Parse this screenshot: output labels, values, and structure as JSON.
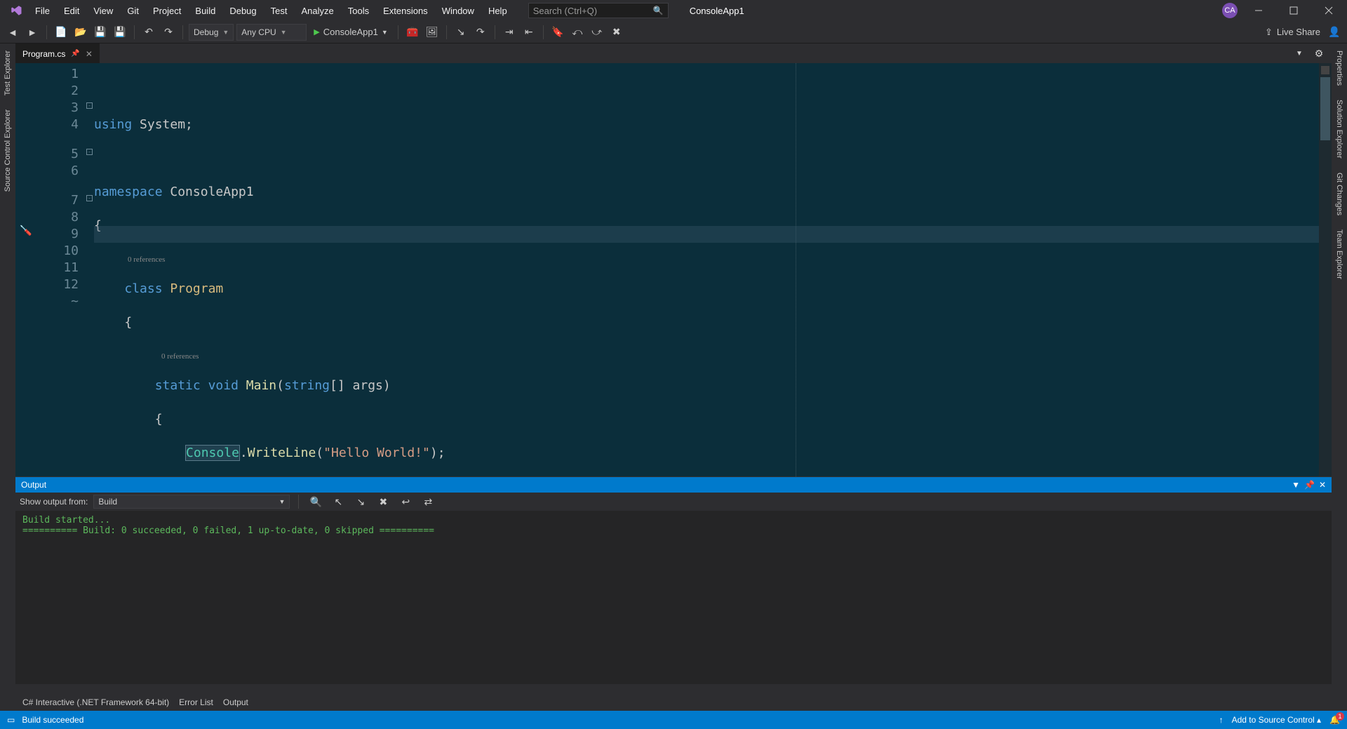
{
  "menu": [
    "File",
    "Edit",
    "View",
    "Git",
    "Project",
    "Build",
    "Debug",
    "Test",
    "Analyze",
    "Tools",
    "Extensions",
    "Window",
    "Help"
  ],
  "search_placeholder": "Search (Ctrl+Q)",
  "app_title": "ConsoleApp1",
  "user_initials": "CA",
  "toolbar": {
    "config": "Debug",
    "platform": "Any CPU",
    "start_target": "ConsoleApp1",
    "live_share": "Live Share"
  },
  "left_rails": [
    "Test Explorer",
    "Source Control Explorer"
  ],
  "right_rails": [
    "Properties",
    "Solution Explorer",
    "Git Changes",
    "Team Explorer"
  ],
  "doc_tab": "Program.cs",
  "code": {
    "line_numbers": [
      "1",
      "2",
      "3",
      "4",
      "",
      "5",
      "6",
      "",
      "7",
      "8",
      "9",
      "10",
      "11",
      "12",
      "~"
    ],
    "codelens1": "0 references",
    "codelens2": "0 references",
    "l1a": "using",
    "l1b": " System;",
    "l3a": "namespace",
    "l3b": " ConsoleApp1",
    "l4": "{",
    "l5a": "    ",
    "l5b": "class",
    "l5c": " ",
    "l5d": "Program",
    "l6": "    {",
    "l7a": "        ",
    "l7b": "static",
    "l7c": " ",
    "l7d": "void",
    "l7e": " ",
    "l7f": "Main",
    "l7g": "(",
    "l7h": "string",
    "l7i": "[] args)",
    "l8": "        {",
    "l9a": "            ",
    "l9b": "Console",
    "l9c": ".",
    "l9d": "WriteLine",
    "l9e": "(",
    "l9f": "\"Hello World!\"",
    "l9g": ");",
    "l10": "        }",
    "l11": "    }",
    "l12": "}"
  },
  "output": {
    "title": "Output",
    "show_from_label": "Show output from:",
    "show_from_value": "Build",
    "lines": [
      "Build started...",
      "========== Build: 0 succeeded, 0 failed, 1 up-to-date, 0 skipped =========="
    ]
  },
  "bottom_tabs": [
    "C# Interactive (.NET Framework 64-bit)",
    "Error List",
    "Output"
  ],
  "status": {
    "left": "Build succeeded",
    "source_control": "Add to Source Control",
    "notifications": "1"
  }
}
